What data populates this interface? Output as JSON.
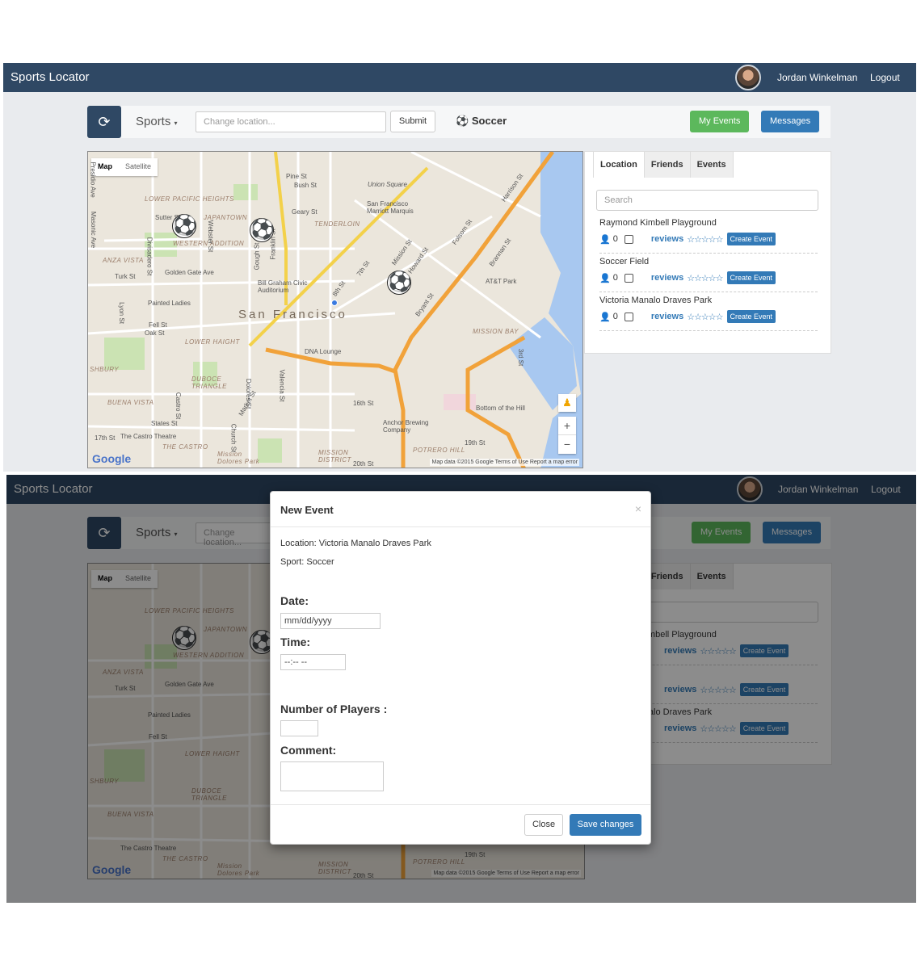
{
  "app": {
    "title": "Sports Locator"
  },
  "user": {
    "name": "Jordan Winkelman",
    "logout_label": "Logout"
  },
  "toolbar": {
    "refresh_icon": "refresh-icon",
    "sports_label": "Sports",
    "location_placeholder": "Change location...",
    "submit_label": "Submit",
    "selected_sport": "Soccer",
    "my_events_label": "My Events",
    "messages_label": "Messages"
  },
  "map": {
    "map_label": "Map",
    "satellite_label": "Satellite",
    "city_label": "San Francisco",
    "google_label": "Google",
    "footer": "Map data ©2015 Google   Terms of Use   Report a map error",
    "zoom_in": "+",
    "zoom_out": "−",
    "labels": {
      "lower_pacific": "LOWER PACIFIC HEIGHTS",
      "japantown": "JAPANTOWN",
      "western_addition": "WESTERN ADDITION",
      "anza_vista": "ANZA VISTA",
      "tenderloin": "TENDERLOIN",
      "union_square": "Union Square",
      "marriott": "San Francisco Marriott Marquis",
      "civic": "Bill Graham Civic Auditorium",
      "painted_ladies": "Painted Ladies",
      "lower_haight": "LOWER HAIGHT",
      "duboce": "DUBOCE TRIANGLE",
      "buena_vista": "BUENA VISTA",
      "castro_theatre": "The Castro Theatre",
      "the_castro": "THE CASTRO",
      "mission_dolores": "Mission Dolores Park",
      "mission_district": "MISSION DISTRICT",
      "mission_bay": "MISSION BAY",
      "att_park": "AT&T Park",
      "dna_lounge": "DNA Lounge",
      "anchor": "Anchor Brewing Company",
      "potrero": "POTRERO HILL",
      "bottom_hill": "Bottom of the Hill",
      "golden_gate": "Golden Gate Ave",
      "turk": "Turk St",
      "fell": "Fell St",
      "oak": "Oak St",
      "geary": "Geary St",
      "pine": "Pine St",
      "bush": "Bush St",
      "sutter": "Sutter St",
      "sixteenth": "16th St",
      "seventeenth": "17th St",
      "nineteenth": "19th St",
      "twentieth": "20th St",
      "market": "Market St",
      "mission": "Mission St",
      "howard": "Howard St",
      "folsom": "Folsom St",
      "harrison": "Harrison St",
      "brannan": "Brannan St",
      "bryant": "Bryant St",
      "third": "3rd St",
      "seventh": "7th St",
      "eighth": "8th St",
      "valencia": "Valencia St",
      "dolores": "Dolores St",
      "church": "Church St",
      "castro": "Castro St",
      "divisadero": "Divisadero St",
      "fillmore": "Webster St",
      "franklin": "Franklin St",
      "gough": "Gough St",
      "presidio": "Presidio Ave",
      "masonic": "Masonic Ave",
      "lyon": "Lyon St",
      "states": "States St",
      "shbury": "SHBURY"
    }
  },
  "panel": {
    "tabs": [
      "Location",
      "Friends",
      "Events"
    ],
    "search_placeholder": "Search",
    "reviews_label": "reviews",
    "stars": "☆☆☆☆☆",
    "create_label": "Create Event",
    "locations": [
      {
        "name": "Raymond Kimbell Playground",
        "count": "0"
      },
      {
        "name": "Soccer Field",
        "count": "0"
      },
      {
        "name": "Victoria Manalo Draves Park",
        "count": "0"
      }
    ],
    "partial_locations": [
      {
        "name": "mbell Playground"
      },
      {
        "name": ""
      },
      {
        "name": "alo Draves Park"
      }
    ]
  },
  "modal": {
    "title": "New Event",
    "close_x": "×",
    "location_line": "Location: Victoria Manalo Draves Park",
    "sport_line": "Sport: Soccer",
    "date_label": "Date:",
    "date_value": "mm/dd/yyyy",
    "time_label": "Time:",
    "time_value": "--:-- --",
    "players_label": "Number of Players :",
    "comment_label": "Comment:",
    "close_label": "Close",
    "save_label": "Save changes"
  }
}
